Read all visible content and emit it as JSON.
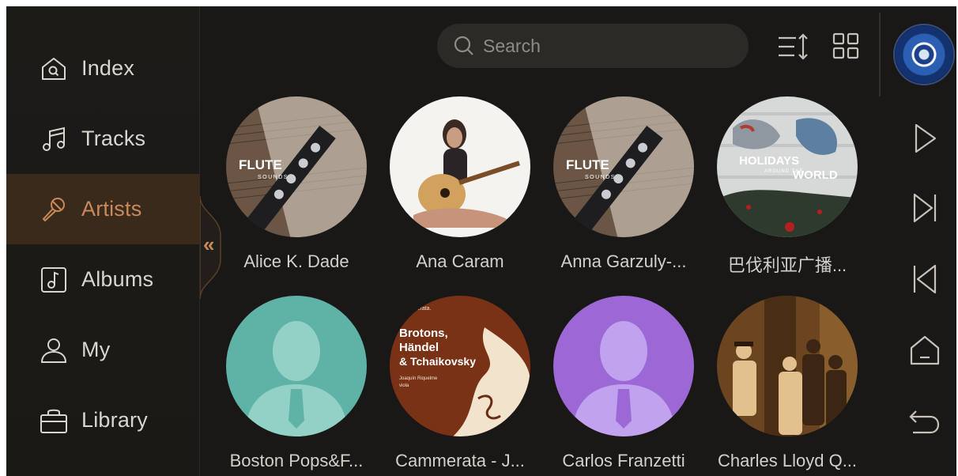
{
  "sidebar": {
    "items": [
      {
        "label": "Index",
        "icon": "home-search-icon",
        "active": false
      },
      {
        "label": "Tracks",
        "icon": "music-note-icon",
        "active": false
      },
      {
        "label": "Artists",
        "icon": "microphone-icon",
        "active": true
      },
      {
        "label": "Albums",
        "icon": "album-icon",
        "active": false
      },
      {
        "label": "My",
        "icon": "user-icon",
        "active": false
      },
      {
        "label": "Library",
        "icon": "library-icon",
        "active": false
      }
    ],
    "collapse_glyph": "«"
  },
  "topbar": {
    "search_placeholder": "Search",
    "sort_icon": "sort-icon",
    "view_icon": "grid-view-icon"
  },
  "right_rail": {
    "now_playing_icon": "album-disc-icon",
    "buttons": [
      "play-icon",
      "next-icon",
      "previous-icon",
      "home-icon",
      "back-icon"
    ]
  },
  "artists": [
    {
      "name": "Alice K. Dade",
      "cover": "flute-sounds",
      "cover_text": [
        "FLUTE",
        "SOUNDS"
      ]
    },
    {
      "name": "Ana Caram",
      "cover": "guitar-photo",
      "cover_text": []
    },
    {
      "name": "Anna Garzuly-...",
      "cover": "flute-sounds",
      "cover_text": [
        "FLUTE",
        "SOUNDS"
      ]
    },
    {
      "name": "巴伐利亚广播...",
      "cover": "holidays-world",
      "cover_text": [
        "HOLIDAYS",
        "AROUND THE",
        "WORLD"
      ]
    },
    {
      "name": "Boston Pops&F...",
      "cover": "placeholder-teal",
      "cover_text": []
    },
    {
      "name": "Cammerata - J...",
      "cover": "cammerata",
      "cover_text": [
        "Cammerata.",
        "Brotons,",
        "Händel",
        "& Tchaikovsky",
        "Joaquín Riquelme",
        "viola"
      ]
    },
    {
      "name": "Carlos Franzetti",
      "cover": "placeholder-purple",
      "cover_text": []
    },
    {
      "name": "Charles Lloyd Q...",
      "cover": "band-photo",
      "cover_text": []
    }
  ],
  "colors": {
    "accent": "#c9895a",
    "background": "#1a1816",
    "active_row": "#3a2a1c",
    "teal": "#5fb3a6",
    "purple": "#9b68d6"
  }
}
